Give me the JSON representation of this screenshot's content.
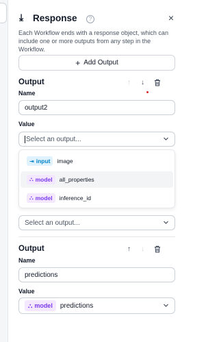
{
  "header": {
    "title": "Response",
    "arrow_icon": "arrow-down-to-line-icon",
    "help_glyph": "?",
    "close_glyph": "×"
  },
  "description": "Each Workflow ends with a response object, which can include one or more outputs from any step in the Workflow.",
  "add_output": {
    "label": "Add Output",
    "plus_glyph": "+"
  },
  "outputs": [
    {
      "title": "Output",
      "name_label": "Name",
      "name_value": "output2",
      "value_label": "Value",
      "value_placeholder": "Select an output...",
      "dropdown_open": true,
      "options": [
        {
          "kind": "input",
          "value": "image"
        },
        {
          "kind": "model",
          "value": "all_properties",
          "highlighted": true
        },
        {
          "kind": "model",
          "value": "inference_id"
        }
      ],
      "second_select_placeholder": "Select an output..."
    },
    {
      "title": "Output",
      "name_label": "Name",
      "name_value": "predictions",
      "value_label": "Value",
      "selected_kind": "model",
      "selected_value": "predictions"
    }
  ],
  "glyphs": {
    "up": "↑",
    "down": "↓",
    "trash": "🗑",
    "chevron": "⌄",
    "input_icon": "⇥",
    "model_icon": "⛬"
  }
}
